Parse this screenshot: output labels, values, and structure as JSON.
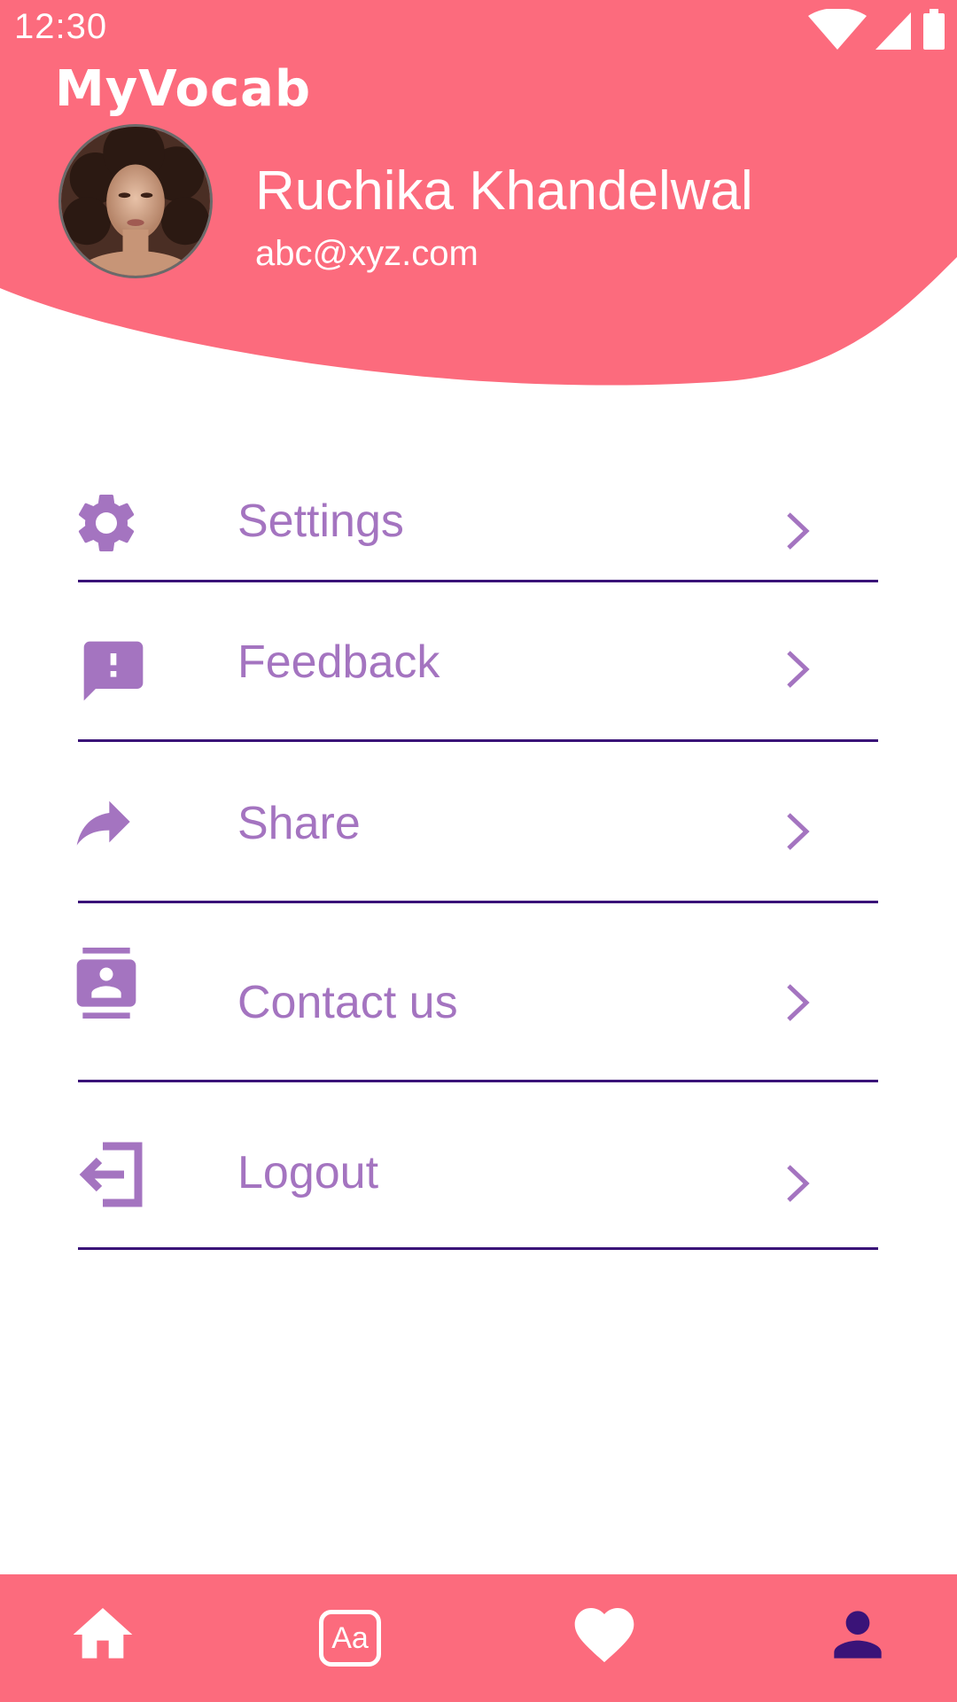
{
  "status_bar": {
    "time": "12:30"
  },
  "app": {
    "title": "MyVocab"
  },
  "profile": {
    "name": "Ruchika Khandelwal",
    "email": "abc@xyz.com"
  },
  "menu": {
    "items": [
      {
        "label": "Settings",
        "icon": "gear-icon"
      },
      {
        "label": "Feedback",
        "icon": "feedback-icon"
      },
      {
        "label": "Share",
        "icon": "share-icon"
      },
      {
        "label": "Contact us",
        "icon": "contact-card-icon"
      },
      {
        "label": "Logout",
        "icon": "logout-icon"
      }
    ]
  },
  "bottom_nav": {
    "items": [
      {
        "name": "home",
        "icon": "home-icon"
      },
      {
        "name": "vocabulary",
        "icon": "aa-text-icon",
        "label": "Aa"
      },
      {
        "name": "favorites",
        "icon": "heart-icon"
      },
      {
        "name": "profile",
        "icon": "person-icon",
        "active": true
      }
    ]
  },
  "colors": {
    "header": "#fc6b7d",
    "menu_text": "#a474c0",
    "divider": "#3a1378",
    "active_nav": "#3a1378",
    "inactive_nav": "#ffffff"
  }
}
